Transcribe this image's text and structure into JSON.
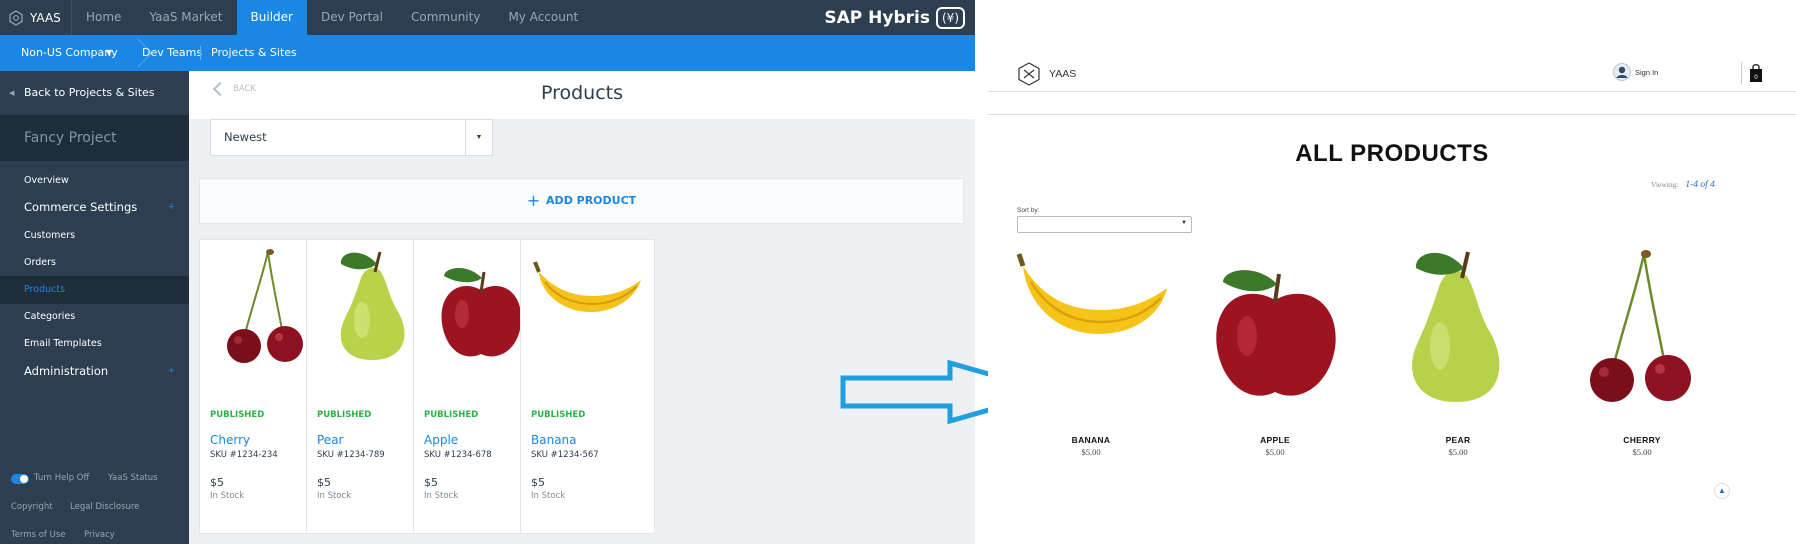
{
  "builder": {
    "logo": "YAAS",
    "nav": [
      "Home",
      "YaaS Market",
      "Builder",
      "Dev Portal",
      "Community",
      "My Account"
    ],
    "brand": "SAP Hybris",
    "brand_mark": "(¥)",
    "subnav": {
      "company": "Non-US Company",
      "dev_teams": "Dev Teams",
      "projects": "Projects & Sites"
    },
    "sidebar": {
      "back": "Back to Projects & Sites",
      "project": "Fancy Project",
      "items": [
        "Overview",
        "Commerce Settings",
        "Customers",
        "Orders",
        "Products",
        "Categories",
        "Email Templates",
        "Administration"
      ],
      "footer": {
        "help": "Turn Help Off",
        "status": "YaaS Status",
        "copyright": "Copyright",
        "legal": "Legal Disclosure",
        "terms": "Terms of Use",
        "privacy": "Privacy"
      }
    },
    "main": {
      "back": "BACK",
      "title": "Products",
      "sort_value": "Newest",
      "add_product": "ADD PRODUCT",
      "cards": [
        {
          "status": "PUBLISHED",
          "name": "Cherry",
          "sku": "SKU #1234-234",
          "price": "$5",
          "stock": "In Stock",
          "image": "cherry"
        },
        {
          "status": "PUBLISHED",
          "name": "Pear",
          "sku": "SKU #1234-789",
          "price": "$5",
          "stock": "In Stock",
          "image": "pear"
        },
        {
          "status": "PUBLISHED",
          "name": "Apple",
          "sku": "SKU #1234-678",
          "price": "$5",
          "stock": "In Stock",
          "image": "apple"
        },
        {
          "status": "PUBLISHED",
          "name": "Banana",
          "sku": "SKU #1234-567",
          "price": "$5",
          "stock": "In Stock",
          "image": "banana"
        }
      ]
    }
  },
  "store": {
    "logo": "YAAS",
    "sign_in": "Sign In",
    "cart_count": "0",
    "title": "ALL PRODUCTS",
    "viewing_label": "Viewing:",
    "viewing_range": "1-4 of 4",
    "sort_label": "Sort by:",
    "products": [
      {
        "name": "BANANA",
        "price": "$5.00",
        "image": "banana"
      },
      {
        "name": "APPLE",
        "price": "$5.00",
        "image": "apple"
      },
      {
        "name": "PEAR",
        "price": "$5.00",
        "image": "pear"
      },
      {
        "name": "CHERRY",
        "price": "$5.00",
        "image": "cherry"
      }
    ]
  },
  "colors": {
    "nav_dark": "#2c3e50",
    "accent_blue": "#1a87e4",
    "published_green": "#2bb34b",
    "arrow_blue": "#1e9fe0"
  },
  "icons": [
    "hexagon-logo-icon",
    "caret-down-icon",
    "chevron-left-icon",
    "plus-icon",
    "user-avatar-icon",
    "shopping-bag-icon",
    "arrow-right-icon",
    "chevron-up-icon"
  ]
}
